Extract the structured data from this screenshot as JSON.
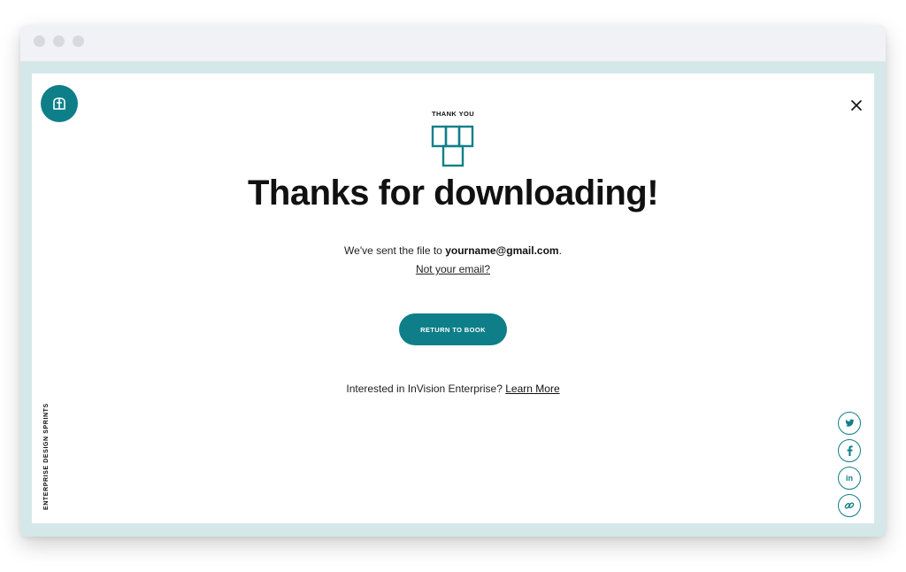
{
  "browser": {
    "controls": [
      "window-dot-1",
      "window-dot-2",
      "window-dot-3"
    ]
  },
  "page": {
    "side_label": "ENTERPRISE DESIGN SPRINTS",
    "eyebrow": "THANK YOU",
    "headline": "Thanks for downloading!",
    "sent_prefix": "We've sent the file to ",
    "email": "yourname@gmail.com",
    "sent_suffix": ".",
    "not_email_link": "Not your email?",
    "return_button": "RETURN TO BOOK",
    "interested_text": "Interested in InVision Enterprise? ",
    "learn_more": "Learn More"
  },
  "share": {
    "twitter_glyph": "t",
    "facebook_glyph": "f",
    "linkedin_glyph": "in"
  },
  "colors": {
    "accent": "#0e7f89",
    "frame": "#d5e8e9",
    "titlebar": "#f1f2f6"
  },
  "icons": [
    "logo-book-icon",
    "close-icon",
    "t-blocks-icon",
    "twitter-icon",
    "facebook-icon",
    "linkedin-icon",
    "link-icon"
  ]
}
